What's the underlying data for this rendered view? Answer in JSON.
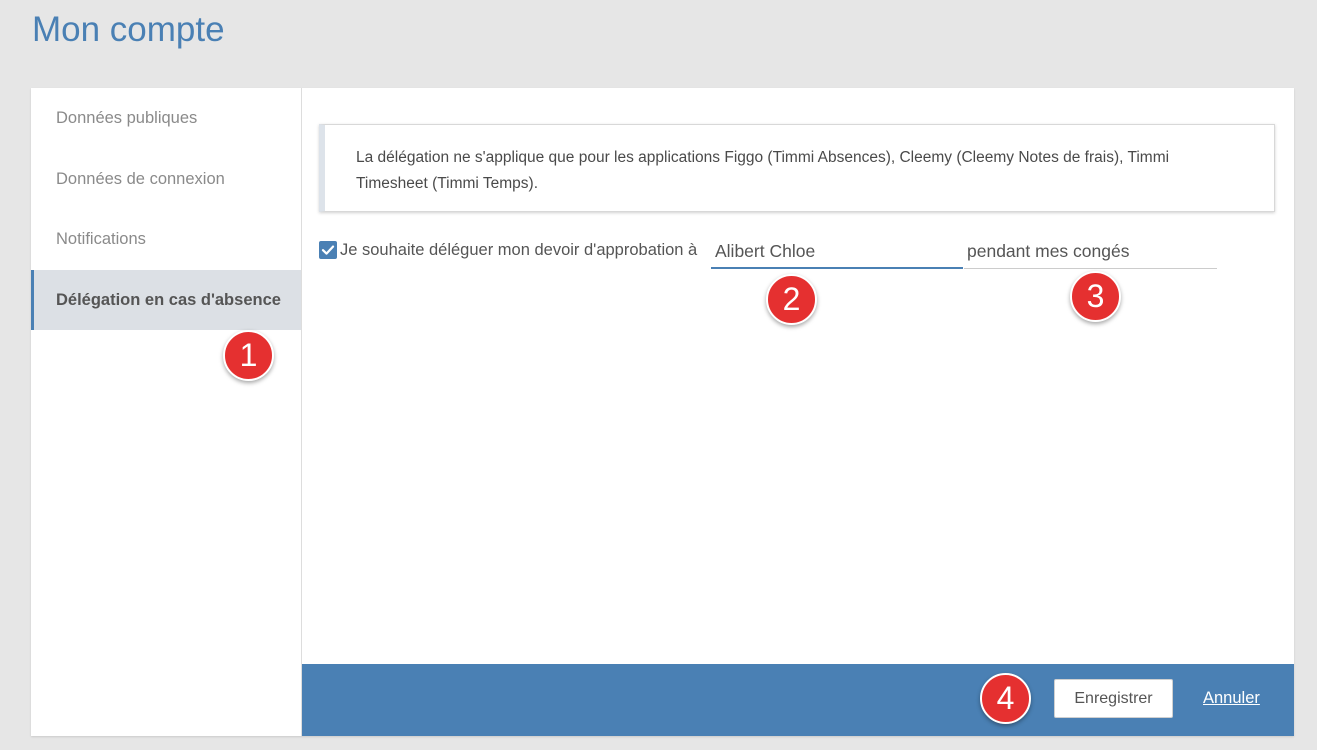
{
  "page": {
    "title": "Mon compte"
  },
  "sidebar": {
    "items": [
      {
        "label": "Données publiques"
      },
      {
        "label": "Données de connexion"
      },
      {
        "label": "Notifications"
      },
      {
        "label": "Délégation en cas d'absence",
        "active": true
      }
    ]
  },
  "main": {
    "info_text": "La délégation ne s'applique que pour les applications Figgo (Timmi Absences), Cleemy (Cleemy Notes de frais), Timmi Timesheet (Timmi Temps).",
    "delegation": {
      "checked": true,
      "checkbox_label": "Je souhaite déléguer mon devoir d'approbation à",
      "delegate_value": "Alibert Chloe",
      "period_value": "pendant mes congés"
    }
  },
  "footer": {
    "save_label": "Enregistrer",
    "cancel_label": "Annuler"
  },
  "annotations": [
    "1",
    "2",
    "3",
    "4"
  ],
  "colors": {
    "accent": "#4a80b4",
    "background": "#e6e6e6",
    "active_item_bg": "#dce0e5",
    "badge": "#e53030"
  }
}
